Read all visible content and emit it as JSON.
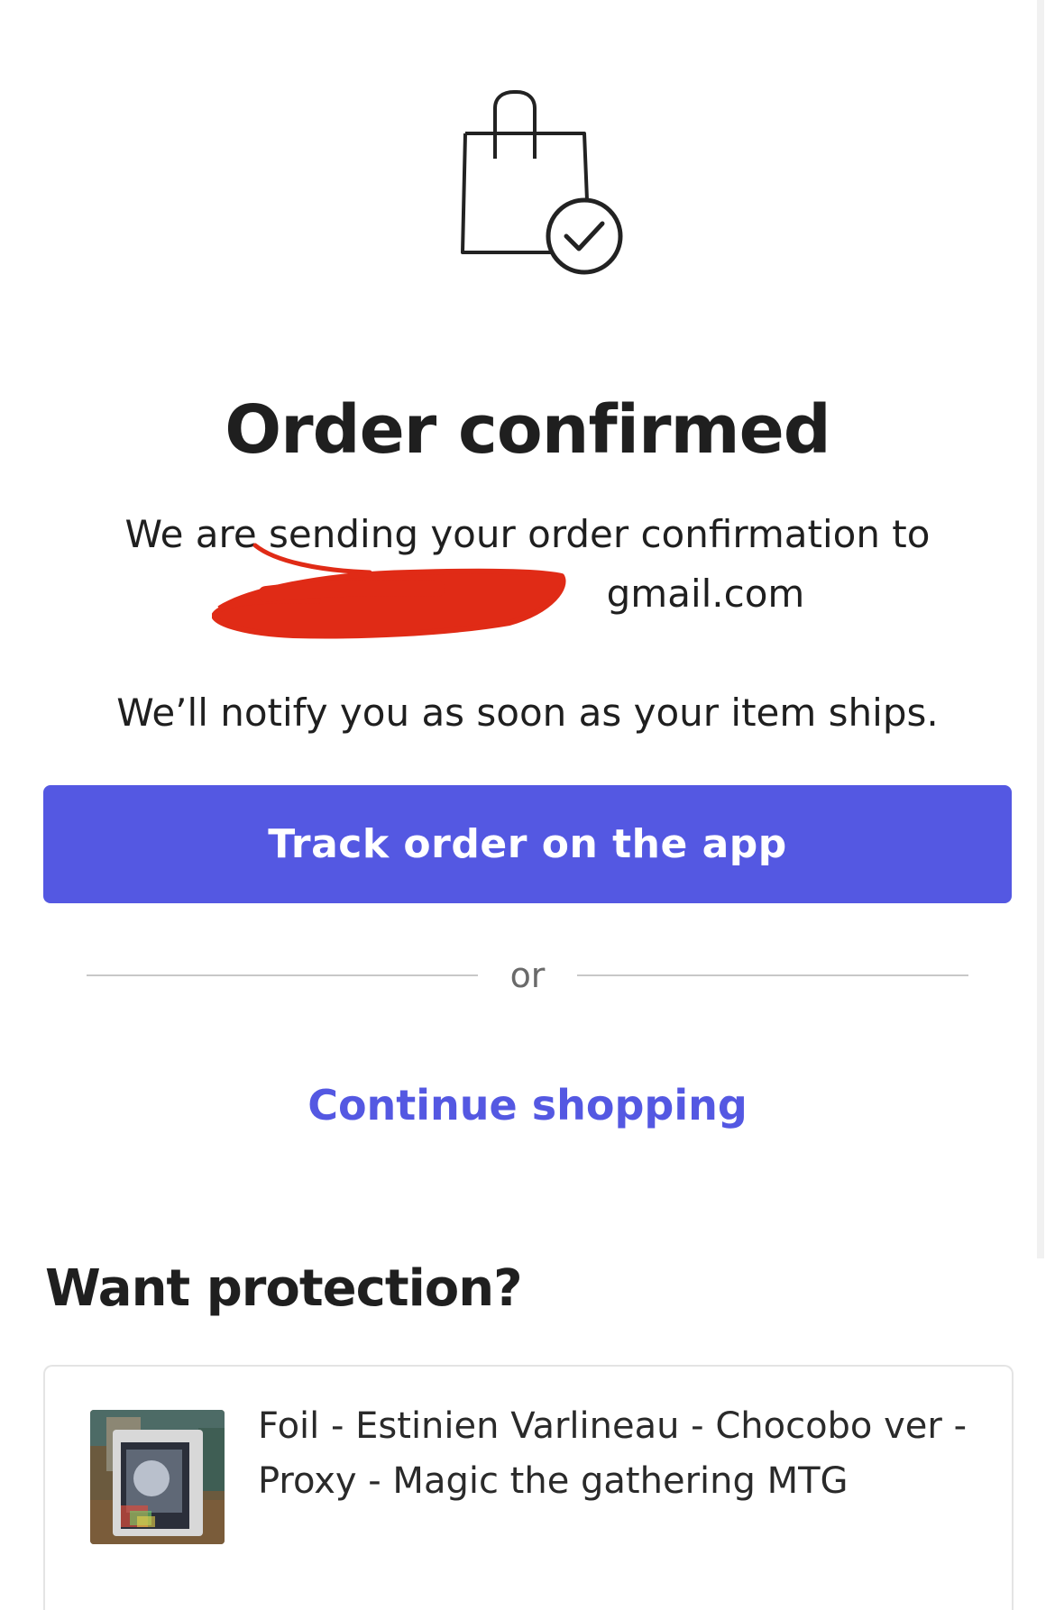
{
  "confirmation": {
    "title": "Order confirmed",
    "message_line1": "We are sending your order confirmation to",
    "email_visible_suffix": "gmail.com",
    "notify_message": "We’ll notify you as soon as your item ships."
  },
  "actions": {
    "track_button_label": "Track order on the app",
    "divider_label": "or",
    "continue_link_label": "Continue shopping"
  },
  "protection": {
    "heading": "Want protection?",
    "item_title": "Foil - Estinien Varlineau - Chocobo ver - Proxy - Magic the gathering MTG"
  },
  "icons": {
    "bag": "shopping-bag-check-icon"
  },
  "colors": {
    "accent": "#5458E2",
    "text": "#1F1F1F",
    "muted": "#6A6A6A",
    "redaction": "#E02B16"
  }
}
